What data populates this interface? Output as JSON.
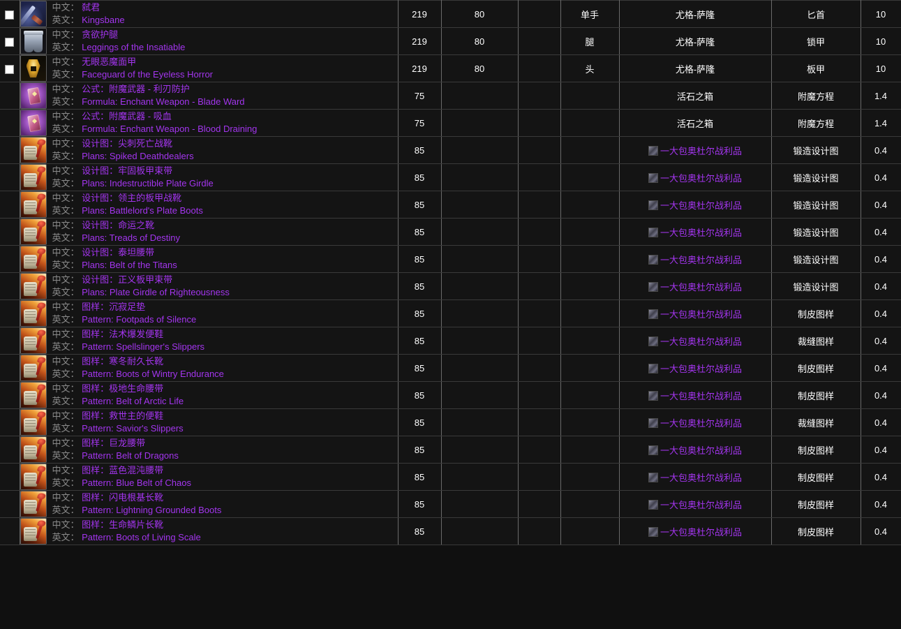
{
  "labels": {
    "zh_prefix": "中文：",
    "en_prefix": "英文："
  },
  "colors": {
    "epic_purple": "#a335ee",
    "label_gray": "#8a8a8a",
    "row_bg": "#141414",
    "grid_line": "#6a6a6a"
  },
  "icons": {
    "checkbox": "checkbox-unchecked-icon",
    "dagger": "dagger-item-icon",
    "legs": "leggings-item-icon",
    "helm": "helm-item-icon",
    "formula": "formula-tome-item-icon",
    "plans": "plans-scroll-item-icon",
    "bag": "loot-bag-mini-icon"
  },
  "rows": [
    {
      "checkbox": true,
      "icon": "dagger",
      "zh": "弑君",
      "en": "Kingsbane",
      "ilvl": "219",
      "req_level": "80",
      "blank": "",
      "slot": "单手",
      "source": "尤格-萨隆",
      "source_link": false,
      "type": "匕首",
      "drop": "10"
    },
    {
      "checkbox": true,
      "icon": "legs",
      "zh": "贪欲护腿",
      "en": "Leggings of the Insatiable",
      "ilvl": "219",
      "req_level": "80",
      "blank": "",
      "slot": "腿",
      "source": "尤格-萨隆",
      "source_link": false,
      "type": "锁甲",
      "drop": "10"
    },
    {
      "checkbox": true,
      "icon": "helm",
      "zh": "无眼恶魔面甲",
      "en": "Faceguard of the Eyeless Horror",
      "ilvl": "219",
      "req_level": "80",
      "blank": "",
      "slot": "头",
      "source": "尤格-萨隆",
      "source_link": false,
      "type": "板甲",
      "drop": "10"
    },
    {
      "checkbox": false,
      "icon": "formula",
      "zh": "公式：附魔武器 - 利刃防护",
      "en": "Formula: Enchant Weapon - Blade Ward",
      "ilvl": "75",
      "req_level": "",
      "blank": "",
      "slot": "",
      "source": "活石之箱",
      "source_link": false,
      "type": "附魔方程",
      "drop": "1.4"
    },
    {
      "checkbox": false,
      "icon": "formula",
      "zh": "公式：附魔武器 - 吸血",
      "en": "Formula: Enchant Weapon - Blood Draining",
      "ilvl": "75",
      "req_level": "",
      "blank": "",
      "slot": "",
      "source": "活石之箱",
      "source_link": false,
      "type": "附魔方程",
      "drop": "1.4"
    },
    {
      "checkbox": false,
      "icon": "plans",
      "zh": "设计图：尖刺死亡战靴",
      "en": "Plans: Spiked Deathdealers",
      "ilvl": "85",
      "req_level": "",
      "blank": "",
      "slot": "",
      "source": "一大包奥杜尔战利品",
      "source_link": true,
      "type": "锻造设计图",
      "drop": "0.4"
    },
    {
      "checkbox": false,
      "icon": "plans",
      "zh": "设计图：牢固板甲束带",
      "en": "Plans: Indestructible Plate Girdle",
      "ilvl": "85",
      "req_level": "",
      "blank": "",
      "slot": "",
      "source": "一大包奥杜尔战利品",
      "source_link": true,
      "type": "锻造设计图",
      "drop": "0.4"
    },
    {
      "checkbox": false,
      "icon": "plans",
      "zh": "设计图：领主的板甲战靴",
      "en": "Plans: Battlelord's Plate Boots",
      "ilvl": "85",
      "req_level": "",
      "blank": "",
      "slot": "",
      "source": "一大包奥杜尔战利品",
      "source_link": true,
      "type": "锻造设计图",
      "drop": "0.4"
    },
    {
      "checkbox": false,
      "icon": "plans",
      "zh": "设计图：命运之靴",
      "en": "Plans: Treads of Destiny",
      "ilvl": "85",
      "req_level": "",
      "blank": "",
      "slot": "",
      "source": "一大包奥杜尔战利品",
      "source_link": true,
      "type": "锻造设计图",
      "drop": "0.4"
    },
    {
      "checkbox": false,
      "icon": "plans",
      "zh": "设计图：泰坦腰带",
      "en": "Plans: Belt of the Titans",
      "ilvl": "85",
      "req_level": "",
      "blank": "",
      "slot": "",
      "source": "一大包奥杜尔战利品",
      "source_link": true,
      "type": "锻造设计图",
      "drop": "0.4"
    },
    {
      "checkbox": false,
      "icon": "plans",
      "zh": "设计图：正义板甲束带",
      "en": "Plans: Plate Girdle of Righteousness",
      "ilvl": "85",
      "req_level": "",
      "blank": "",
      "slot": "",
      "source": "一大包奥杜尔战利品",
      "source_link": true,
      "type": "锻造设计图",
      "drop": "0.4"
    },
    {
      "checkbox": false,
      "icon": "plans",
      "zh": "图样：沉寂足垫",
      "en": "Pattern: Footpads of Silence",
      "ilvl": "85",
      "req_level": "",
      "blank": "",
      "slot": "",
      "source": "一大包奥杜尔战利品",
      "source_link": true,
      "type": "制皮图样",
      "drop": "0.4"
    },
    {
      "checkbox": false,
      "icon": "plans",
      "zh": "图样：法术爆发便鞋",
      "en": "Pattern: Spellslinger's Slippers",
      "ilvl": "85",
      "req_level": "",
      "blank": "",
      "slot": "",
      "source": "一大包奥杜尔战利品",
      "source_link": true,
      "type": "裁缝图样",
      "drop": "0.4"
    },
    {
      "checkbox": false,
      "icon": "plans",
      "zh": "图样：寒冬耐久长靴",
      "en": "Pattern: Boots of Wintry Endurance",
      "ilvl": "85",
      "req_level": "",
      "blank": "",
      "slot": "",
      "source": "一大包奥杜尔战利品",
      "source_link": true,
      "type": "制皮图样",
      "drop": "0.4"
    },
    {
      "checkbox": false,
      "icon": "plans",
      "zh": "图样：极地生命腰带",
      "en": "Pattern: Belt of Arctic Life",
      "ilvl": "85",
      "req_level": "",
      "blank": "",
      "slot": "",
      "source": "一大包奥杜尔战利品",
      "source_link": true,
      "type": "制皮图样",
      "drop": "0.4"
    },
    {
      "checkbox": false,
      "icon": "plans",
      "zh": "图样：救世主的便鞋",
      "en": "Pattern: Savior's Slippers",
      "ilvl": "85",
      "req_level": "",
      "blank": "",
      "slot": "",
      "source": "一大包奥杜尔战利品",
      "source_link": true,
      "type": "裁缝图样",
      "drop": "0.4"
    },
    {
      "checkbox": false,
      "icon": "plans",
      "zh": "图样：巨龙腰带",
      "en": "Pattern: Belt of Dragons",
      "ilvl": "85",
      "req_level": "",
      "blank": "",
      "slot": "",
      "source": "一大包奥杜尔战利品",
      "source_link": true,
      "type": "制皮图样",
      "drop": "0.4"
    },
    {
      "checkbox": false,
      "icon": "plans",
      "zh": "图样：蓝色混沌腰带",
      "en": "Pattern: Blue Belt of Chaos",
      "ilvl": "85",
      "req_level": "",
      "blank": "",
      "slot": "",
      "source": "一大包奥杜尔战利品",
      "source_link": true,
      "type": "制皮图样",
      "drop": "0.4"
    },
    {
      "checkbox": false,
      "icon": "plans",
      "zh": "图样：闪电根基长靴",
      "en": "Pattern: Lightning Grounded Boots",
      "ilvl": "85",
      "req_level": "",
      "blank": "",
      "slot": "",
      "source": "一大包奥杜尔战利品",
      "source_link": true,
      "type": "制皮图样",
      "drop": "0.4"
    },
    {
      "checkbox": false,
      "icon": "plans",
      "zh": "图样：生命鳞片长靴",
      "en": "Pattern: Boots of Living Scale",
      "ilvl": "85",
      "req_level": "",
      "blank": "",
      "slot": "",
      "source": "一大包奥杜尔战利品",
      "source_link": true,
      "type": "制皮图样",
      "drop": "0.4"
    }
  ]
}
